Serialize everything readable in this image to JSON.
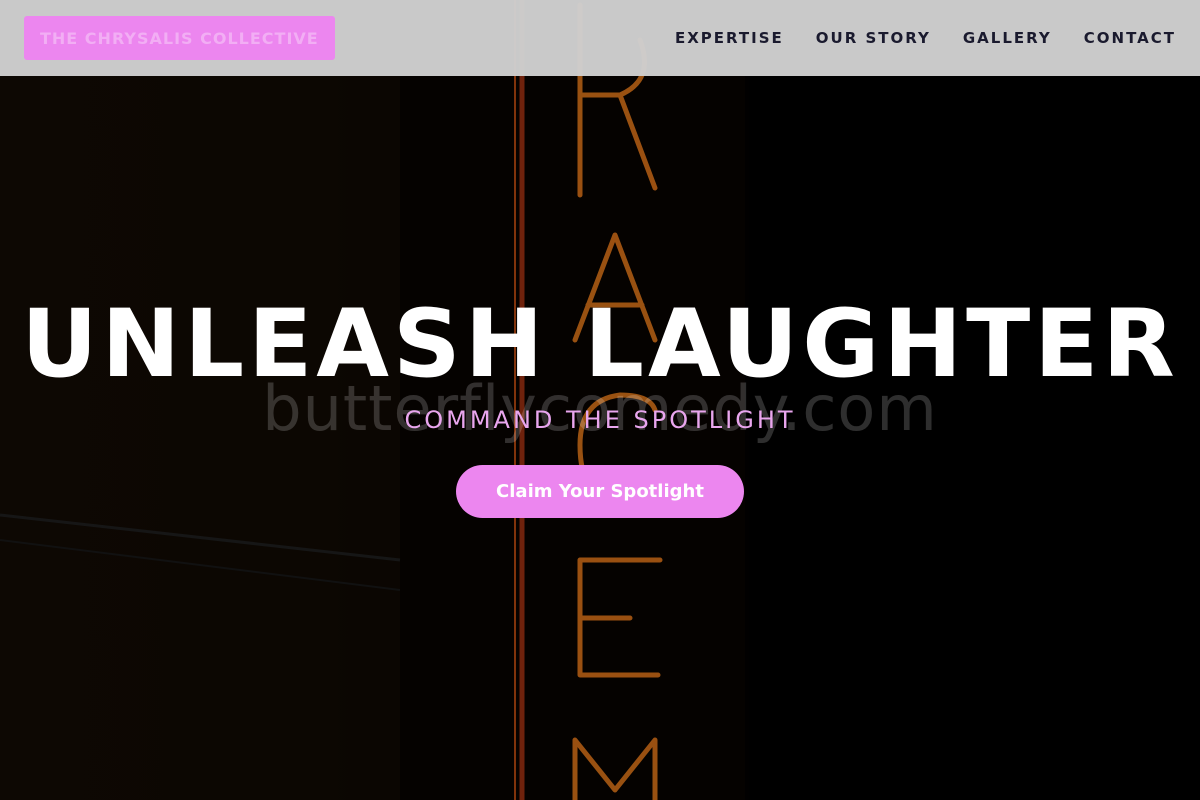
{
  "brand": {
    "logo_text": "THE CHRYSALIS COLLECTIVE",
    "accent_color": "#ec86ef"
  },
  "nav": {
    "items": [
      {
        "label": "EXPERTISE"
      },
      {
        "label": "OUR STORY"
      },
      {
        "label": "GALLERY"
      },
      {
        "label": "CONTACT"
      }
    ]
  },
  "hero": {
    "headline": "UNLEASH LAUGHTER",
    "watermark": "butterflycomedy.com",
    "subheadline": "COMMAND THE SPOTLIGHT",
    "cta_label": "Claim Your Spotlight",
    "background_image": "neon-theater-sign"
  }
}
